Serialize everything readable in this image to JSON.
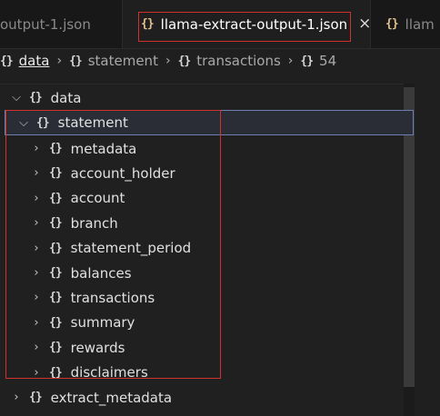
{
  "tabs": {
    "prev_label": "output-1.json",
    "active_label": "llama-extract-output-1.json",
    "active_icon": "{}",
    "active_close": "×",
    "next_label": "llam",
    "next_icon": "{}"
  },
  "breadcrumb": {
    "icon": "{}",
    "items": [
      "data",
      "statement",
      "transactions",
      "54"
    ],
    "separator": "›"
  },
  "tree": {
    "brace": "{}",
    "root": {
      "label": "data",
      "expanded": true
    },
    "selected": {
      "label": "statement",
      "expanded": true
    },
    "children": [
      "metadata",
      "account_holder",
      "account",
      "branch",
      "statement_period",
      "balances",
      "transactions",
      "summary",
      "rewards",
      "disclaimers"
    ],
    "sibling": {
      "label": "extract_metadata",
      "expanded": false
    }
  },
  "colors": {
    "annotation": "#d0302e",
    "json_icon": "#e2c08d",
    "selection_outline": "#6c7fb0"
  }
}
